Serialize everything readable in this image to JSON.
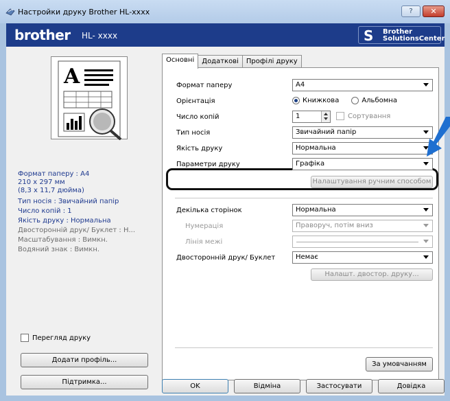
{
  "window": {
    "title": "Настройки друку Brother HL-xxxx",
    "help_label": "?",
    "close_label": "✕"
  },
  "header": {
    "brand": "brother",
    "model": "HL- xxxx",
    "solutions_line1": "Brother",
    "solutions_line2": "SolutionsCenter"
  },
  "summary": {
    "lines": [
      "Формат паперу : A4",
      "210 x 297 мм",
      "(8,3 x 11,7 дюйма)",
      "Тип носія : Звичайний папір",
      "Число копій : 1",
      "Якість друку : Нормальна",
      "Двосторонній друк/ Буклет : Н...",
      "Масштабування : Вимкн.",
      "Водяний знак : Вимкн."
    ]
  },
  "left": {
    "preview_label": "Перегляд друку",
    "add_profile": "Додати профіль...",
    "support": "Підтримка..."
  },
  "tabs": [
    "Основні",
    "Додаткові",
    "Профілі друку"
  ],
  "basic": {
    "paper_size_label": "Формат паперу",
    "paper_size_value": "A4",
    "orientation_label": "Орієнтація",
    "portrait": "Книжкова",
    "landscape": "Альбомна",
    "copies_label": "Число копій",
    "copies_value": "1",
    "collate": "Сортування",
    "media_type_label": "Тип носія",
    "media_type_value": "Звичайний папір",
    "quality_label": "Якість друку",
    "quality_value": "Нормальна",
    "print_settings_label": "Параметри друку",
    "print_settings_value": "Графіка",
    "manual_settings": "Налаштування ручним способом",
    "multiple_pages_label": "Декілька сторінок",
    "multiple_pages_value": "Нормальна",
    "page_order_label": "Нумерація",
    "page_order_value": "Праворуч, потім вниз",
    "border_line_label": "Лінія межі",
    "duplex_label": "Двосторонній друк/ Буклет",
    "duplex_value": "Немає",
    "duplex_settings": "Налашт. двостор. друку...",
    "default": "За умовчанням"
  },
  "footer": {
    "ok": "OK",
    "cancel": "Відміна",
    "apply": "Застосувати",
    "help": "Довідка"
  },
  "colors": {
    "brand_blue": "#1d3c8a",
    "summary_blue": "#1f3a8f",
    "arrow_blue": "#1f6fd0"
  }
}
